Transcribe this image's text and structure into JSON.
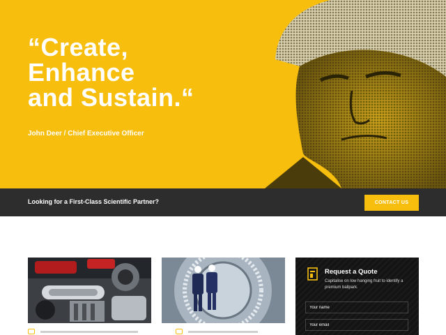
{
  "hero": {
    "quote_lines": [
      "“Create,",
      "Enhance",
      "and Sustain.“"
    ],
    "author": "John Deer / Chief Executive Officer",
    "accent_color": "#f7be0e",
    "photo_icon": "worker-hardhat-photo"
  },
  "strip": {
    "text": "Looking for a First-Class Scientific Partner?",
    "button_label": "CONTACT US",
    "background": "#2d2d2d"
  },
  "cards": [
    {
      "image": "engine-parts-photo",
      "icon": "gear-icon"
    },
    {
      "image": "engineers-turbine-photo",
      "icon": "gear-icon"
    }
  ],
  "quote_form": {
    "title": "Request a Quote",
    "subtitle": "Capitalise on low hanging fruit to identify a premium ballpark.",
    "icon": "quote-document-icon",
    "name_placeholder": "Your name",
    "email_placeholder": "Your email"
  }
}
